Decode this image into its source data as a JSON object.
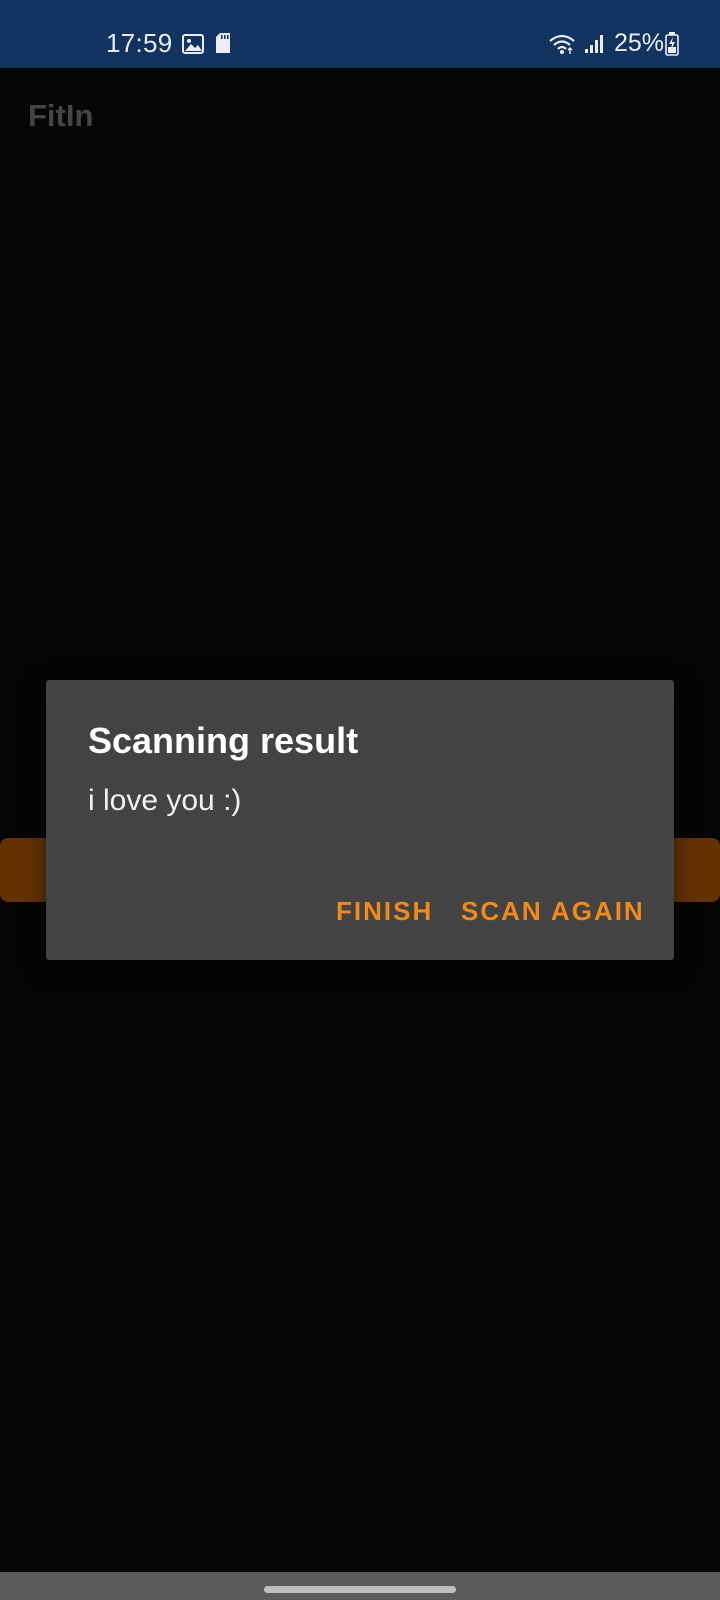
{
  "status_bar": {
    "time": "17:59",
    "battery": "25%",
    "icons": [
      "image-icon",
      "sd-card-icon",
      "wifi-icon",
      "signal-icon",
      "battery-charging-icon"
    ],
    "background_color": "#12325f"
  },
  "app": {
    "title": "FitIn"
  },
  "dialog": {
    "title": "Scanning result",
    "message": "i love you :)",
    "buttons": {
      "finish": "FINISH",
      "scan_again": "SCAN AGAIN"
    },
    "accent_color": "#f28a1a"
  }
}
